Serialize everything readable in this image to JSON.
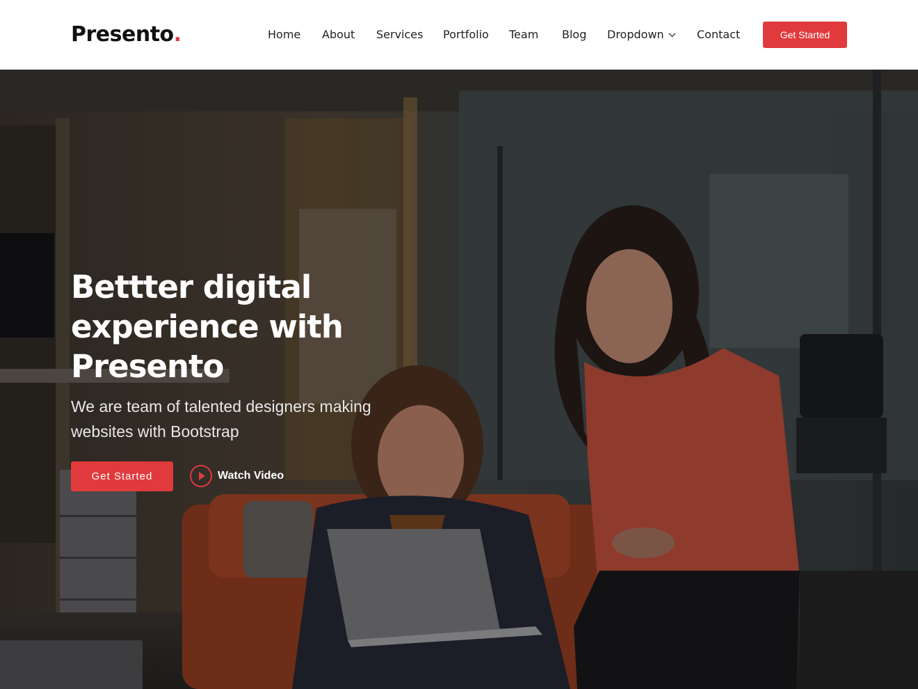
{
  "brand": {
    "name": "Presento",
    "dot": ".",
    "accent": "#e03a3c"
  },
  "nav": {
    "items": [
      {
        "label": "Home"
      },
      {
        "label": "About"
      },
      {
        "label": "Services"
      },
      {
        "label": "Portfolio"
      },
      {
        "label": "Team"
      },
      {
        "label": "Blog"
      },
      {
        "label": "Dropdown",
        "icon": "chevron-down-icon"
      },
      {
        "label": "Contact"
      }
    ],
    "cta_label": "Get Started"
  },
  "hero": {
    "title_lines": [
      "Bettter digital",
      "experience with",
      "Presento"
    ],
    "subtitle": "We are team of talented designers making websites with Bootstrap",
    "primary_button": "Get Started",
    "video_link": "Watch Video",
    "video_icon": "play-icon"
  }
}
